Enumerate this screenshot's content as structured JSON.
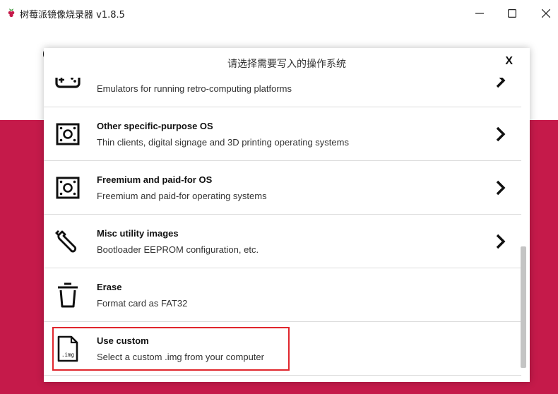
{
  "window": {
    "title": "树莓派镜像烧录器 v1.8.5",
    "icon": "raspberry-icon",
    "controls": {
      "minimize": "minimize-icon",
      "maximize": "maximize-icon",
      "close": "close-icon"
    }
  },
  "background": {
    "partial_heading": "C",
    "accent_color": "#c51a4a"
  },
  "dialog": {
    "title": "请选择需要写入的操作系统",
    "close_label": "X",
    "items": [
      {
        "title": "",
        "description": "Emulators for running retro-computing platforms",
        "icon": "gamepad-icon",
        "has_chevron": true
      },
      {
        "title": "Other specific-purpose OS",
        "description": "Thin clients, digital signage and 3D printing operating systems",
        "icon": "board-icon",
        "has_chevron": true
      },
      {
        "title": "Freemium and paid-for OS",
        "description": "Freemium and paid-for operating systems",
        "icon": "board-icon",
        "has_chevron": true
      },
      {
        "title": "Misc utility images",
        "description": "Bootloader EEPROM configuration, etc.",
        "icon": "wrench-icon",
        "has_chevron": true
      },
      {
        "title": "Erase",
        "description": "Format card as FAT32",
        "icon": "trash-icon",
        "has_chevron": false
      },
      {
        "title": "Use custom",
        "description": "Select a custom .img from your computer",
        "icon": "img-file-icon",
        "icon_label": ".img",
        "has_chevron": false,
        "highlighted": true
      }
    ],
    "highlight_color": "#e0262d"
  }
}
